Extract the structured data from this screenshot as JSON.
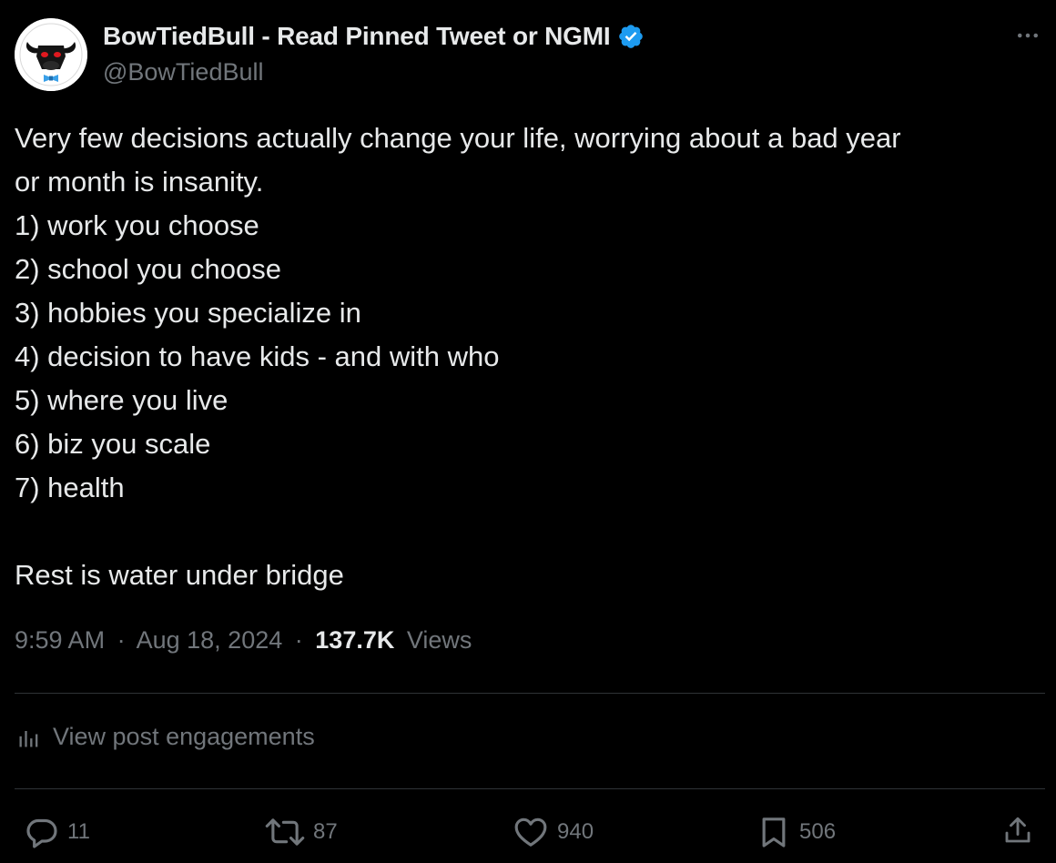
{
  "author": {
    "display_name": "BowTiedBull - Read Pinned Tweet or NGMI",
    "handle": "@BowTiedBull",
    "verified_color": "#1d9bf0",
    "avatar_icon": "bull-avatar-icon"
  },
  "tweet": {
    "lines": [
      "Very few decisions actually change your life, worrying about a bad year",
      "or month is insanity.",
      "1) work you choose",
      "2) school you choose",
      "3) hobbies you specialize in",
      "4) decision to have kids - and with who",
      "5) where you live",
      "6) biz you scale",
      "7) health",
      "Rest is water under bridge"
    ]
  },
  "meta": {
    "time": "9:59 AM",
    "separator": "·",
    "date": "Aug 18, 2024",
    "views_count": "137.7K",
    "views_label": "Views"
  },
  "engagements": {
    "label": "View post engagements",
    "icon": "analytics-icon"
  },
  "actions": {
    "replies": "11",
    "reposts": "87",
    "likes": "940",
    "bookmarks": "506"
  },
  "colors": {
    "background": "#000000",
    "text_primary": "#e7e9ea",
    "text_secondary": "#71767b",
    "divider": "#2f3336",
    "accent": "#1d9bf0"
  }
}
